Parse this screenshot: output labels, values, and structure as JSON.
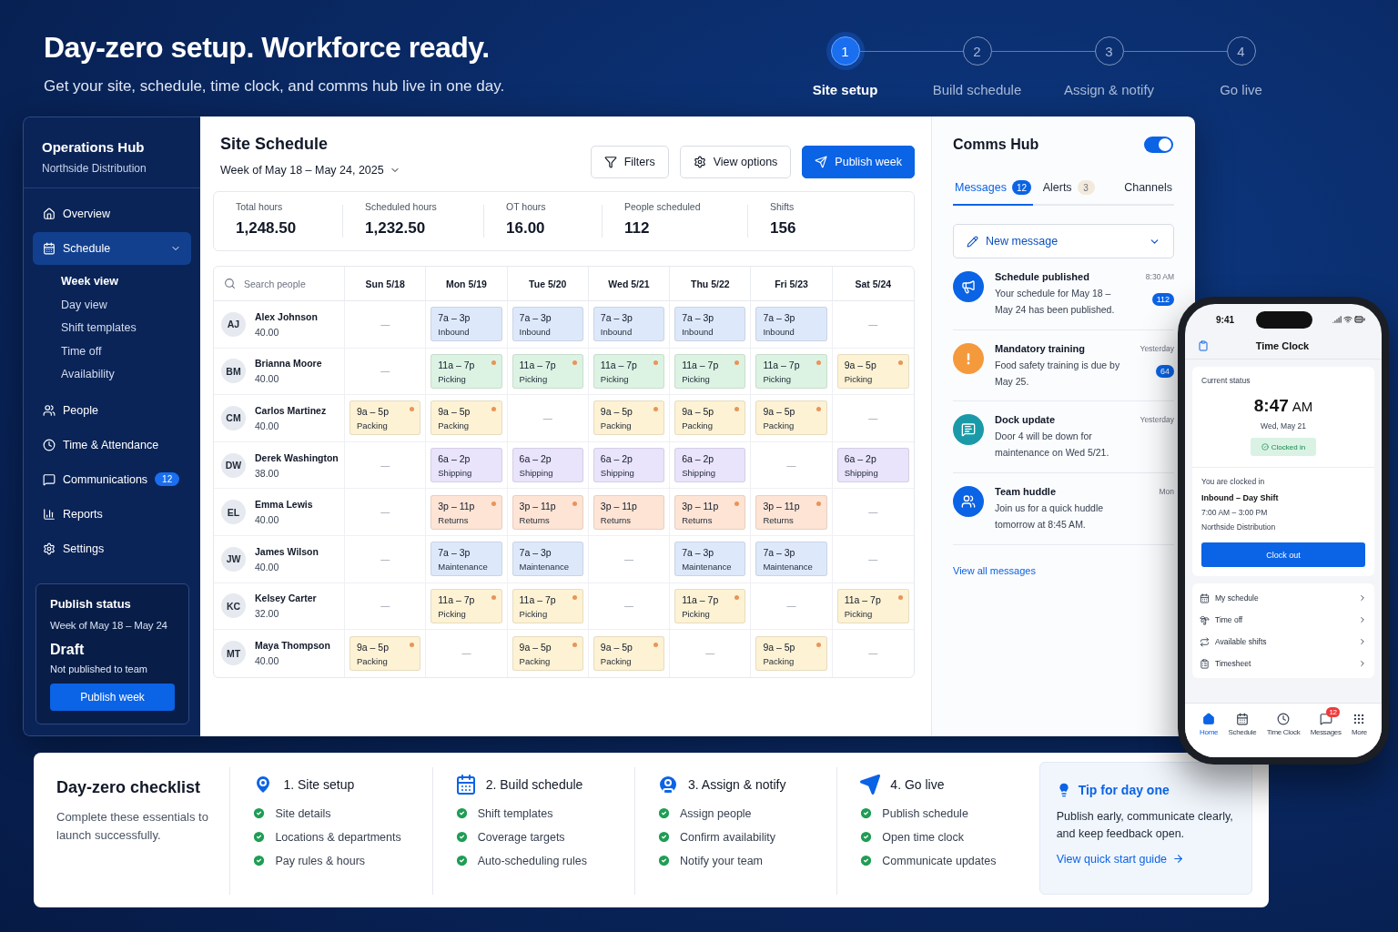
{
  "header": {
    "title": "Day-zero setup. Workforce ready.",
    "subtitle": "Get your site, schedule, time clock, and comms hub live in one day."
  },
  "steps": [
    {
      "number": "1",
      "label": "Site setup",
      "selected": true
    },
    {
      "number": "2",
      "label": "Build schedule",
      "selected": false
    },
    {
      "number": "3",
      "label": "Assign & notify",
      "selected": false
    },
    {
      "number": "4",
      "label": "Go live",
      "selected": false
    }
  ],
  "sidebar": {
    "title": "Operations Hub",
    "subtitle": "Northside Distribution",
    "items": [
      {
        "label": "Overview",
        "selected": false
      },
      {
        "label": "Schedule",
        "selected": true,
        "children": [
          {
            "label": "Week view",
            "selected": true
          },
          {
            "label": "Day view",
            "selected": false
          },
          {
            "label": "Shift templates",
            "selected": false
          },
          {
            "label": "Time off",
            "selected": false
          },
          {
            "label": "Availability",
            "selected": false
          }
        ]
      },
      {
        "label": "People",
        "selected": false
      },
      {
        "label": "Time & Attendance",
        "selected": false
      },
      {
        "label": "Communications",
        "selected": false,
        "badge": "12"
      },
      {
        "label": "Reports",
        "selected": false
      },
      {
        "label": "Settings",
        "selected": false
      }
    ],
    "publish_status": {
      "title": "Publish status",
      "week": "Week of May 18 – May 24",
      "state": "Draft",
      "note": "Not published to team",
      "button": "Publish week"
    }
  },
  "schedule": {
    "title": "Site Schedule",
    "week": "Week of May 18 – May 24, 2025",
    "buttons": [
      {
        "kind": "filter",
        "label": "Filters"
      },
      {
        "kind": "options",
        "label": "View options"
      },
      {
        "kind": "publish",
        "label": "Publish week"
      }
    ],
    "stats": [
      {
        "label": "Total hours",
        "value": "1,248.50"
      },
      {
        "label": "Scheduled hours",
        "value": "1,232.50"
      },
      {
        "label": "OT hours",
        "value": "16.00"
      },
      {
        "label": "People scheduled",
        "value": "112"
      },
      {
        "label": "Shifts",
        "value": "156"
      }
    ],
    "search_placeholder": "Search people",
    "days": [
      "Sun 5/18",
      "Mon 5/19",
      "Tue 5/20",
      "Wed 5/21",
      "Thu 5/22",
      "Fri 5/23",
      "Sat 5/24"
    ],
    "employees": [
      {
        "initials": "AJ",
        "name": "Alex Johnson",
        "hours": "40.00",
        "shifts": [
          {
            "kind": "empty",
            "text": "—"
          },
          {
            "kind": "shift",
            "time": "7a – 3p",
            "dept": "Inbound",
            "color": "#dde9fb",
            "flagged": false
          },
          {
            "kind": "shift",
            "time": "7a – 3p",
            "dept": "Inbound",
            "color": "#dde9fb",
            "flagged": false
          },
          {
            "kind": "shift",
            "time": "7a – 3p",
            "dept": "Inbound",
            "color": "#dde9fb",
            "flagged": false
          },
          {
            "kind": "shift",
            "time": "7a – 3p",
            "dept": "Inbound",
            "color": "#dde9fb",
            "flagged": false
          },
          {
            "kind": "shift",
            "time": "7a – 3p",
            "dept": "Inbound",
            "color": "#dde9fb",
            "flagged": false
          },
          {
            "kind": "empty",
            "text": "—"
          }
        ]
      },
      {
        "initials": "BM",
        "name": "Brianna Moore",
        "hours": "40.00",
        "shifts": [
          {
            "kind": "empty",
            "text": "—"
          },
          {
            "kind": "shift",
            "time": "11a – 7p",
            "dept": "Picking",
            "color": "#dcf3e3",
            "flagged": true
          },
          {
            "kind": "shift",
            "time": "11a – 7p",
            "dept": "Picking",
            "color": "#dcf3e3",
            "flagged": true
          },
          {
            "kind": "shift",
            "time": "11a – 7p",
            "dept": "Picking",
            "color": "#dcf3e3",
            "flagged": true
          },
          {
            "kind": "shift",
            "time": "11a – 7p",
            "dept": "Picking",
            "color": "#dcf3e3",
            "flagged": true
          },
          {
            "kind": "shift",
            "time": "11a – 7p",
            "dept": "Picking",
            "color": "#dcf3e3",
            "flagged": true
          },
          {
            "kind": "shift",
            "time": "9a – 5p",
            "dept": "Picking",
            "color": "#fdf2d3",
            "flagged": true
          }
        ]
      },
      {
        "initials": "CM",
        "name": "Carlos Martinez",
        "hours": "40.00",
        "shifts": [
          {
            "kind": "shift",
            "time": "9a – 5p",
            "dept": "Packing",
            "color": "#fdf2d3",
            "flagged": true
          },
          {
            "kind": "shift",
            "time": "9a – 5p",
            "dept": "Packing",
            "color": "#fdf2d3",
            "flagged": true
          },
          {
            "kind": "empty",
            "text": "—"
          },
          {
            "kind": "shift",
            "time": "9a – 5p",
            "dept": "Packing",
            "color": "#fdf2d3",
            "flagged": true
          },
          {
            "kind": "shift",
            "time": "9a – 5p",
            "dept": "Packing",
            "color": "#fdf2d3",
            "flagged": true
          },
          {
            "kind": "shift",
            "time": "9a – 5p",
            "dept": "Packing",
            "color": "#fdf2d3",
            "flagged": true
          },
          {
            "kind": "empty",
            "text": "—"
          }
        ]
      },
      {
        "initials": "DW",
        "name": "Derek Washington",
        "hours": "38.00",
        "shifts": [
          {
            "kind": "empty",
            "text": "—"
          },
          {
            "kind": "shift",
            "time": "6a – 2p",
            "dept": "Shipping",
            "color": "#e9e3fb",
            "flagged": false
          },
          {
            "kind": "shift",
            "time": "6a – 2p",
            "dept": "Shipping",
            "color": "#e9e3fb",
            "flagged": false
          },
          {
            "kind": "shift",
            "time": "6a – 2p",
            "dept": "Shipping",
            "color": "#e9e3fb",
            "flagged": false
          },
          {
            "kind": "shift",
            "time": "6a – 2p",
            "dept": "Shipping",
            "color": "#e9e3fb",
            "flagged": false
          },
          {
            "kind": "empty",
            "text": "—"
          },
          {
            "kind": "shift",
            "time": "6a – 2p",
            "dept": "Shipping",
            "color": "#e9e3fb",
            "flagged": false
          }
        ]
      },
      {
        "initials": "EL",
        "name": "Emma Lewis",
        "hours": "40.00",
        "shifts": [
          {
            "kind": "empty",
            "text": "—"
          },
          {
            "kind": "shift",
            "time": "3p – 11p",
            "dept": "Returns",
            "color": "#fde4d5",
            "flagged": true
          },
          {
            "kind": "shift",
            "time": "3p – 11p",
            "dept": "Returns",
            "color": "#fde4d5",
            "flagged": true
          },
          {
            "kind": "shift",
            "time": "3p – 11p",
            "dept": "Returns",
            "color": "#fde4d5",
            "flagged": false
          },
          {
            "kind": "shift",
            "time": "3p – 11p",
            "dept": "Returns",
            "color": "#fde4d5",
            "flagged": true
          },
          {
            "kind": "shift",
            "time": "3p – 11p",
            "dept": "Returns",
            "color": "#fde4d5",
            "flagged": true
          },
          {
            "kind": "empty",
            "text": "—"
          }
        ]
      },
      {
        "initials": "JW",
        "name": "James Wilson",
        "hours": "40.00",
        "shifts": [
          {
            "kind": "empty",
            "text": "—"
          },
          {
            "kind": "shift",
            "time": "7a – 3p",
            "dept": "Maintenance",
            "color": "#dde9fb",
            "flagged": false
          },
          {
            "kind": "shift",
            "time": "7a – 3p",
            "dept": "Maintenance",
            "color": "#dde9fb",
            "flagged": false
          },
          {
            "kind": "empty",
            "text": "—"
          },
          {
            "kind": "shift",
            "time": "7a – 3p",
            "dept": "Maintenance",
            "color": "#dde9fb",
            "flagged": false
          },
          {
            "kind": "shift",
            "time": "7a – 3p",
            "dept": "Maintenance",
            "color": "#dde9fb",
            "flagged": false
          },
          {
            "kind": "empty",
            "text": "—"
          }
        ]
      },
      {
        "initials": "KC",
        "name": "Kelsey Carter",
        "hours": "32.00",
        "shifts": [
          {
            "kind": "empty",
            "text": "—"
          },
          {
            "kind": "shift",
            "time": "11a – 7p",
            "dept": "Picking",
            "color": "#fdf2d3",
            "flagged": true
          },
          {
            "kind": "shift",
            "time": "11a – 7p",
            "dept": "Picking",
            "color": "#fdf2d3",
            "flagged": true
          },
          {
            "kind": "empty",
            "text": "—"
          },
          {
            "kind": "shift",
            "time": "11a – 7p",
            "dept": "Picking",
            "color": "#fdf2d3",
            "flagged": true
          },
          {
            "kind": "empty",
            "text": "—"
          },
          {
            "kind": "shift",
            "time": "11a – 7p",
            "dept": "Picking",
            "color": "#fdf2d3",
            "flagged": true
          }
        ]
      },
      {
        "initials": "MT",
        "name": "Maya Thompson",
        "hours": "40.00",
        "shifts": [
          {
            "kind": "shift",
            "time": "9a – 5p",
            "dept": "Packing",
            "color": "#fdf2d3",
            "flagged": true
          },
          {
            "kind": "empty",
            "text": "—"
          },
          {
            "kind": "shift",
            "time": "9a – 5p",
            "dept": "Packing",
            "color": "#fdf2d3",
            "flagged": true
          },
          {
            "kind": "shift",
            "time": "9a – 5p",
            "dept": "Packing",
            "color": "#fdf2d3",
            "flagged": true
          },
          {
            "kind": "empty",
            "text": "—"
          },
          {
            "kind": "shift",
            "time": "9a – 5p",
            "dept": "Packing",
            "color": "#fdf2d3",
            "flagged": true
          },
          {
            "kind": "empty",
            "text": "—"
          }
        ]
      }
    ]
  },
  "comms": {
    "title": "Comms Hub",
    "on": true,
    "tabs": [
      {
        "label": "Messages",
        "count": "12",
        "selected": true
      },
      {
        "label": "Alerts",
        "count": "3",
        "selected": false
      },
      {
        "label": "Channels",
        "selected": false
      }
    ],
    "new_message": "New message",
    "messages": [
      {
        "color": "#0b63e5",
        "title": "Schedule published",
        "body": "Your schedule for May 18 – May 24 has been published.",
        "time": "8:30 AM",
        "count": "112"
      },
      {
        "color": "#f59a3c",
        "title": "Mandatory training",
        "body": "Food safety training is due by May 25.",
        "time": "Yesterday",
        "count": "64"
      },
      {
        "color": "#1a9aa8",
        "title": "Dock update",
        "body": "Door 4 will be down for maintenance on Wed 5/21.",
        "time": "Yesterday"
      },
      {
        "color": "#0b63e5",
        "title": "Team huddle",
        "body": "Join us for a quick huddle tomorrow at 8:45 AM.",
        "time": "Mon"
      }
    ],
    "link": "View all messages"
  },
  "phone": {
    "status_time": "9:41",
    "title": "Time Clock",
    "status_label": "Current status",
    "clock": "8:47",
    "ampm": "AM",
    "date": "Wed, May 21",
    "status": "Clocked in",
    "clocked_text": "You are clocked in",
    "shift": "Inbound – Day Shift",
    "hours": "7:00 AM – 3:00 PM",
    "site": "Northside Distribution",
    "button": "Clock out",
    "menu": [
      "My schedule",
      "Time off",
      "Available shifts",
      "Timesheet"
    ],
    "nav": [
      {
        "label": "Home",
        "selected": true
      },
      {
        "label": "Schedule",
        "selected": false
      },
      {
        "label": "Time Clock",
        "selected": false
      },
      {
        "label": "Messages",
        "selected": false,
        "badge": "12"
      },
      {
        "label": "More",
        "selected": false
      }
    ]
  },
  "checklist": {
    "title": "Day-zero checklist",
    "description": "Complete these essentials to launch successfully.",
    "steps": [
      {
        "title": "1. Site setup",
        "items": [
          {
            "label": "Site details",
            "checked": true
          },
          {
            "label": "Locations & departments",
            "checked": true
          },
          {
            "label": "Pay rules & hours",
            "checked": true
          }
        ]
      },
      {
        "title": "2. Build schedule",
        "items": [
          {
            "label": "Shift templates",
            "checked": true
          },
          {
            "label": "Coverage targets",
            "checked": true
          },
          {
            "label": "Auto-scheduling rules",
            "checked": true
          }
        ]
      },
      {
        "title": "3. Assign & notify",
        "items": [
          {
            "label": "Assign people",
            "checked": true
          },
          {
            "label": "Confirm availability",
            "checked": true
          },
          {
            "label": "Notify your team",
            "checked": true
          }
        ]
      },
      {
        "title": "4. Go live",
        "items": [
          {
            "label": "Publish schedule",
            "checked": true
          },
          {
            "label": "Open time clock",
            "checked": true
          },
          {
            "label": "Communicate updates",
            "checked": true
          }
        ]
      }
    ],
    "tip": {
      "title": "Tip for day one",
      "text": "Publish early, communicate clearly, and keep feedback open.",
      "link": "View quick start guide"
    }
  }
}
